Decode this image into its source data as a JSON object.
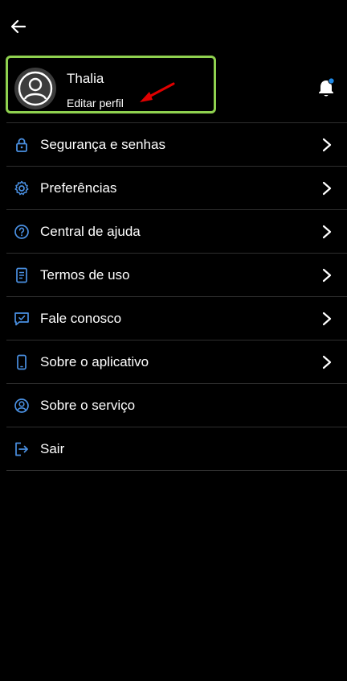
{
  "header": {
    "back_icon": "arrow-left-icon"
  },
  "profile": {
    "name": "Thalia",
    "edit_label": "Editar perfil",
    "avatar_icon": "user-circle-icon"
  },
  "notifications": {
    "icon": "bell-icon",
    "badge_color": "#1e88e5"
  },
  "colors": {
    "accent": "#4a90e2",
    "highlight_border": "#8fd14f",
    "annotation_arrow": "#e00000"
  },
  "menu": {
    "items": [
      {
        "label": "Segurança e senhas",
        "icon": "lock-icon"
      },
      {
        "label": "Preferências",
        "icon": "gear-icon"
      },
      {
        "label": "Central de ajuda",
        "icon": "help-icon"
      },
      {
        "label": "Termos de uso",
        "icon": "document-icon"
      },
      {
        "label": "Fale conosco",
        "icon": "chat-icon"
      },
      {
        "label": "Sobre o aplicativo",
        "icon": "phone-icon"
      },
      {
        "label": "Sobre o serviço",
        "icon": "account-circle-icon"
      },
      {
        "label": "Sair",
        "icon": "logout-icon"
      }
    ]
  }
}
